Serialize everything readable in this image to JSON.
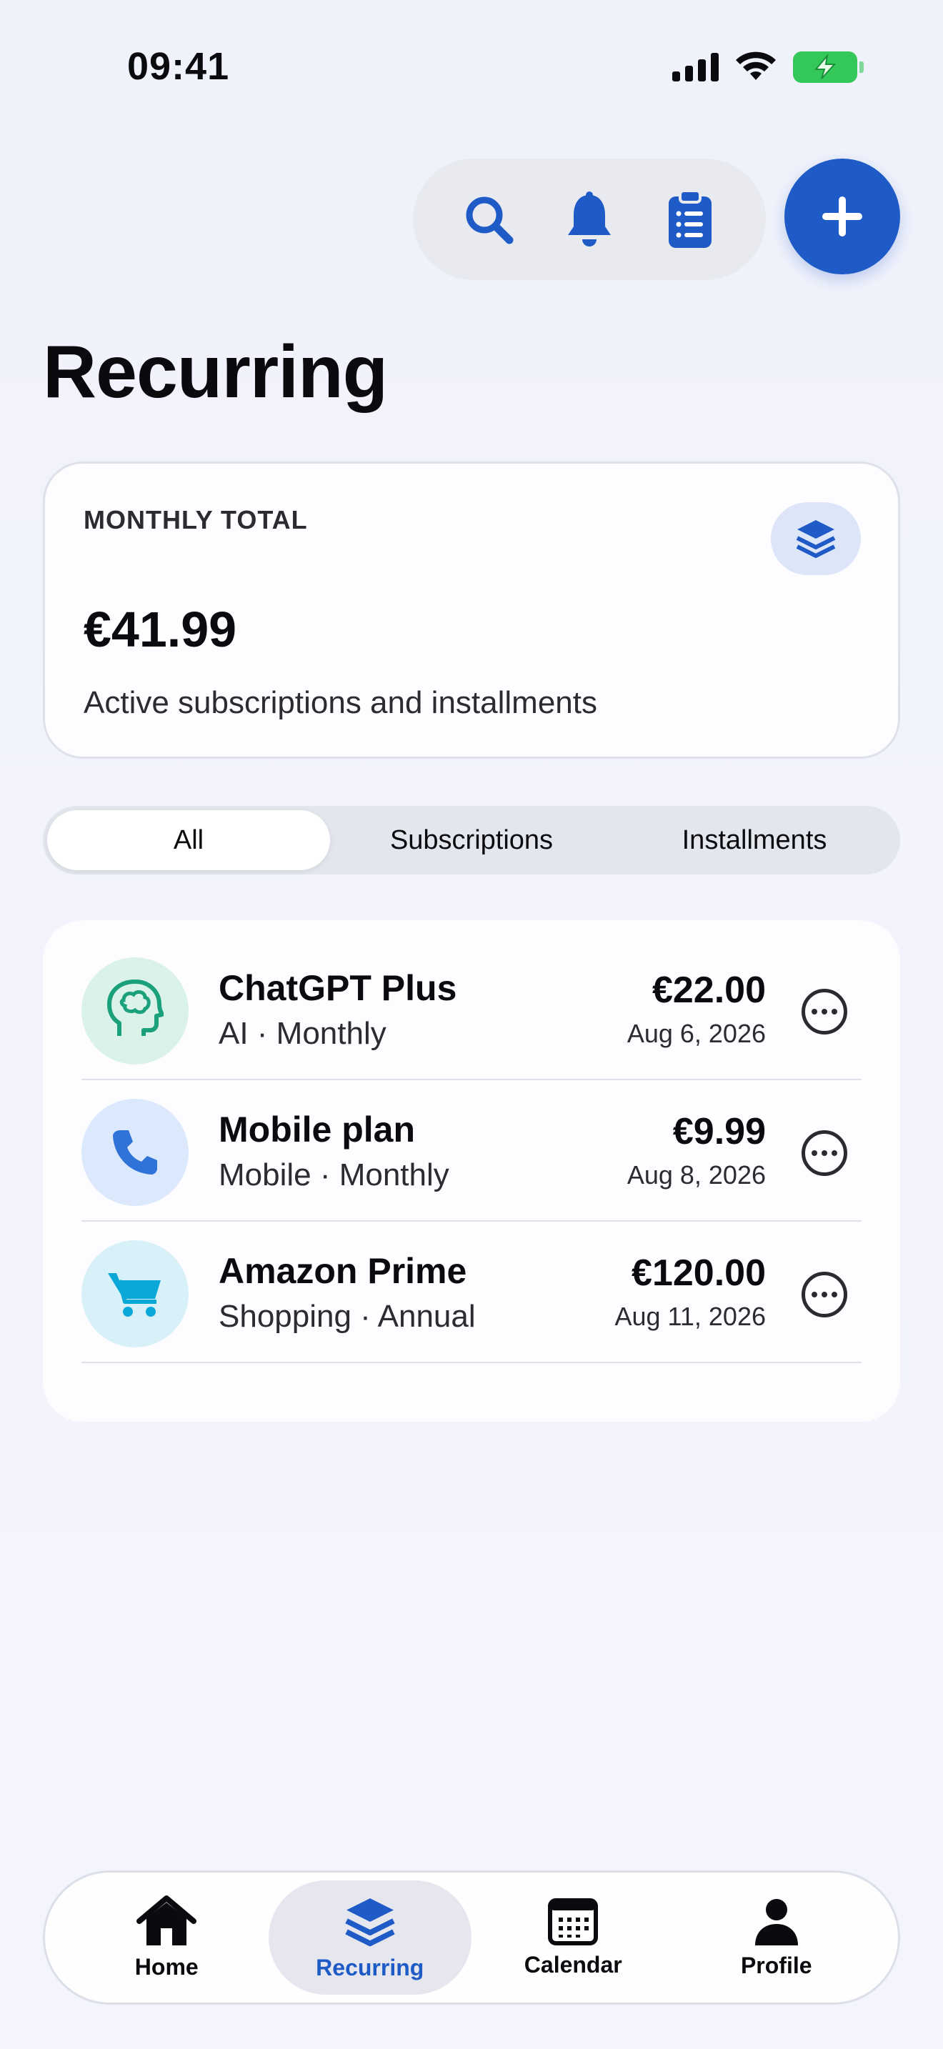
{
  "status_bar": {
    "time": "09:41"
  },
  "page": {
    "title": "Recurring"
  },
  "summary": {
    "label": "MONTHLY TOTAL",
    "amount": "€41.99",
    "subtitle": "Active subscriptions and installments"
  },
  "segments": {
    "all": "All",
    "subscriptions": "Subscriptions",
    "installments": "Installments",
    "selected": "All"
  },
  "items": [
    {
      "name": "ChatGPT Plus",
      "meta": "AI · Monthly",
      "price": "€22.00",
      "date": "Aug 6, 2026",
      "icon": "brain-icon",
      "color": "#1aa07a",
      "bg": "#dbf2ea"
    },
    {
      "name": "Mobile plan",
      "meta": "Mobile · Monthly",
      "price": "€9.99",
      "date": "Aug 8, 2026",
      "icon": "phone-icon",
      "color": "#2f72d8",
      "bg": "#dce8fb"
    },
    {
      "name": "Amazon Prime",
      "meta": "Shopping · Annual",
      "price": "€120.00",
      "date": "Aug 11, 2026",
      "icon": "cart-icon",
      "color": "#0aa8d8",
      "bg": "#d8f0f8"
    }
  ],
  "tabs": {
    "home": "Home",
    "recurring": "Recurring",
    "calendar": "Calendar",
    "profile": "Profile",
    "selected": "Recurring"
  },
  "colors": {
    "accent": "#1f5bc6",
    "background": "#f2f3fb"
  }
}
